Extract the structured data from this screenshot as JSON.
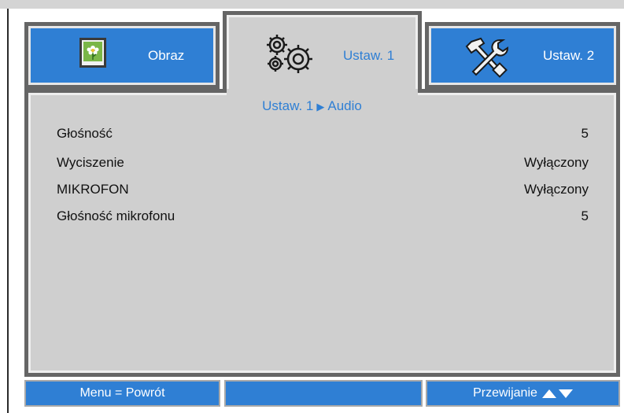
{
  "tabs": [
    {
      "label": "Obraz",
      "icon": "picture-icon",
      "active": false
    },
    {
      "label": "Ustaw. 1",
      "icon": "gears-icon",
      "active": true
    },
    {
      "label": "Ustaw. 2",
      "icon": "tools-icon",
      "active": false
    }
  ],
  "breadcrumb": {
    "parent": "Ustaw. 1",
    "current": "Audio",
    "separator_icon": "triangle-right-icon"
  },
  "items": [
    {
      "label": "Głośność",
      "value": "5"
    },
    {
      "label": "Wyciszenie",
      "value": "Wyłączony"
    },
    {
      "label": "MIKROFON",
      "value": "Wyłączony"
    },
    {
      "label": "Głośność mikrofonu",
      "value": "5"
    }
  ],
  "bottom": {
    "left": "Menu = Powrót",
    "middle": "",
    "right": "Przewijanie",
    "right_icons": [
      "triangle-up-icon",
      "triangle-down-icon"
    ]
  },
  "colors": {
    "accent": "#2f7fd4",
    "panel": "#cfcfcf",
    "border": "#656565"
  }
}
